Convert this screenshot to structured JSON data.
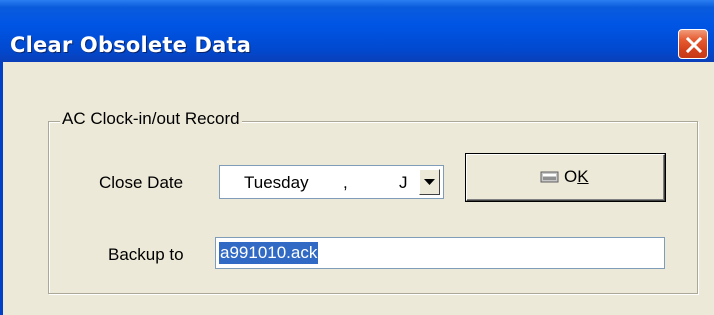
{
  "window": {
    "title": "Clear Obsolete Data"
  },
  "group": {
    "title": "AC Clock-in/out Record"
  },
  "close_date": {
    "label": "Close Date",
    "day": "Tuesday",
    "separator": ",",
    "month_partial": "J"
  },
  "ok_button": {
    "label": "OK"
  },
  "backup": {
    "label": "Backup to",
    "value": "a991010.ack"
  },
  "icons": {
    "close": "close-icon",
    "dropdown": "chevron-down-icon",
    "ok": "eraser-icon",
    "browse": "folder-open-icon"
  },
  "colors": {
    "titlebar": "#0055e5",
    "close_button": "#e65b31",
    "selection": "#316ac5",
    "dialog_background": "#ece9d8"
  }
}
